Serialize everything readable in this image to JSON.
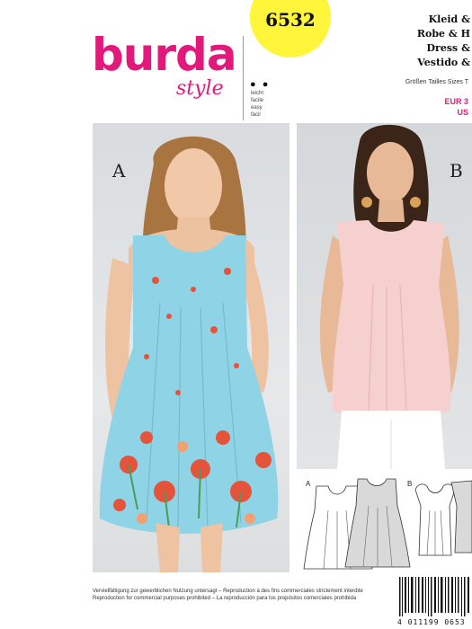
{
  "brand": {
    "name": "burda",
    "sub": "style",
    "color": "#e2187a"
  },
  "pattern_number": "6532",
  "difficulty": {
    "dots": "● ●",
    "lines": [
      "leicht",
      "facile",
      "easy",
      "fácil"
    ]
  },
  "titles": [
    "Kleid &",
    "Robe & H",
    "Dress &",
    "Vestido &"
  ],
  "sizes_title": "Größen Tailles Sizes T",
  "size_eur": "EUR 3",
  "size_us": "US",
  "views": {
    "a": "A",
    "b": "B"
  },
  "sketch_labels": {
    "a": "A",
    "b": "B"
  },
  "footer_lines": [
    "Vervielfältigung zur gewerblichen Nutzung untersagt – Reproduction à des fins commerciales strictement interdite",
    "Reproduction for commercial purposes prohibited – La reproducción para los propósitos comerciales prohibida"
  ],
  "barcode_number": "4 011199 0653",
  "colors": {
    "badge": "#fff53a",
    "dress_a": "#8fd3e6",
    "top_b": "#f6cfcf"
  }
}
